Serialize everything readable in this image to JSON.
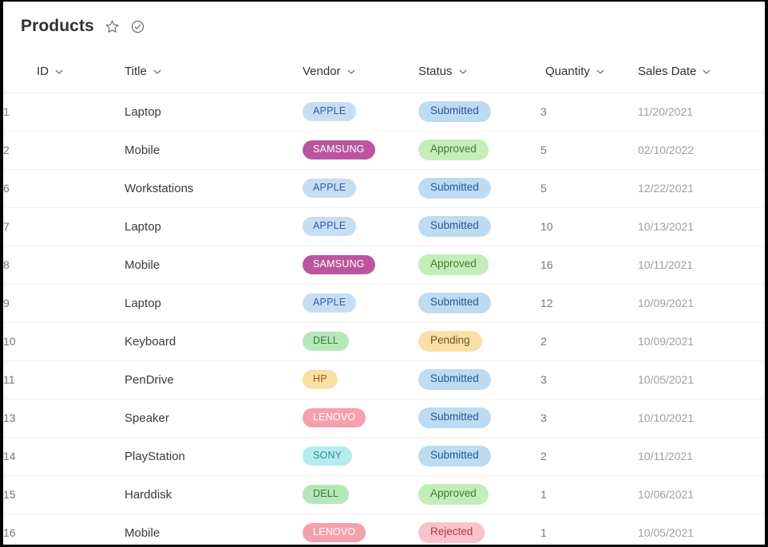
{
  "header": {
    "title": "Products",
    "icons": [
      {
        "name": "favorite-star-icon",
        "glyph": "star"
      },
      {
        "name": "published-check-icon",
        "glyph": "check-circle"
      }
    ]
  },
  "table": {
    "columns": [
      {
        "key": "id",
        "label": "ID",
        "sort_icon": "chevron-down-icon"
      },
      {
        "key": "title",
        "label": "Title",
        "sort_icon": "chevron-down-icon"
      },
      {
        "key": "vendor",
        "label": "Vendor",
        "sort_icon": "chevron-down-icon"
      },
      {
        "key": "status",
        "label": "Status",
        "sort_icon": "chevron-down-icon"
      },
      {
        "key": "quantity",
        "label": "Quantity",
        "sort_icon": "chevron-down-icon"
      },
      {
        "key": "date",
        "label": "Sales Date",
        "sort_icon": "chevron-down-icon"
      }
    ],
    "rows": [
      {
        "id": "1",
        "title": "Laptop",
        "vendor": "APPLE",
        "status": "Submitted",
        "quantity": "3",
        "date": "11/20/2021"
      },
      {
        "id": "2",
        "title": "Mobile",
        "vendor": "SAMSUNG",
        "status": "Approved",
        "quantity": "5",
        "date": "02/10/2022"
      },
      {
        "id": "6",
        "title": "Workstations",
        "vendor": "APPLE",
        "status": "Submitted",
        "quantity": "5",
        "date": "12/22/2021"
      },
      {
        "id": "7",
        "title": "Laptop",
        "vendor": "APPLE",
        "status": "Submitted",
        "quantity": "10",
        "date": "10/13/2021"
      },
      {
        "id": "8",
        "title": "Mobile",
        "vendor": "SAMSUNG",
        "status": "Approved",
        "quantity": "16",
        "date": "10/11/2021"
      },
      {
        "id": "9",
        "title": "Laptop",
        "vendor": "APPLE",
        "status": "Submitted",
        "quantity": "12",
        "date": "10/09/2021"
      },
      {
        "id": "10",
        "title": "Keyboard",
        "vendor": "DELL",
        "status": "Pending",
        "quantity": "2",
        "date": "10/09/2021"
      },
      {
        "id": "11",
        "title": "PenDrive",
        "vendor": "HP",
        "status": "Submitted",
        "quantity": "3",
        "date": "10/05/2021"
      },
      {
        "id": "13",
        "title": "Speaker",
        "vendor": "LENOVO",
        "status": "Submitted",
        "quantity": "3",
        "date": "10/10/2021"
      },
      {
        "id": "14",
        "title": "PlayStation",
        "vendor": "SONY",
        "status": "Submitted",
        "quantity": "2",
        "date": "10/11/2021"
      },
      {
        "id": "15",
        "title": "Harddisk",
        "vendor": "DELL",
        "status": "Approved",
        "quantity": "1",
        "date": "10/06/2021"
      },
      {
        "id": "16",
        "title": "Mobile",
        "vendor": "LENOVO",
        "status": "Rejected",
        "quantity": "1",
        "date": "10/05/2021"
      }
    ]
  },
  "styles": {
    "vendor": {
      "APPLE": {
        "bg": "#c7ddf2",
        "fg": "#2b5fa8"
      },
      "SAMSUNG": {
        "bg": "#b9569f",
        "fg": "#ffffff"
      },
      "DELL": {
        "bg": "#b6e7b8",
        "fg": "#2f7a34"
      },
      "HP": {
        "bg": "#fbe0a6",
        "fg": "#8a6214"
      },
      "LENOVO": {
        "bg": "#f5a0ad",
        "fg": "#ffffff"
      },
      "SONY": {
        "bg": "#b5ecef",
        "fg": "#2f8f96"
      }
    },
    "status": {
      "Submitted": {
        "bg": "#bedbf2",
        "fg": "#1f5a9e"
      },
      "Approved": {
        "bg": "#c4eeb9",
        "fg": "#3f7d2f"
      },
      "Pending": {
        "bg": "#fbdfa8",
        "fg": "#6f5520"
      },
      "Rejected": {
        "bg": "#f9c3cb",
        "fg": "#b03a4c"
      }
    }
  }
}
